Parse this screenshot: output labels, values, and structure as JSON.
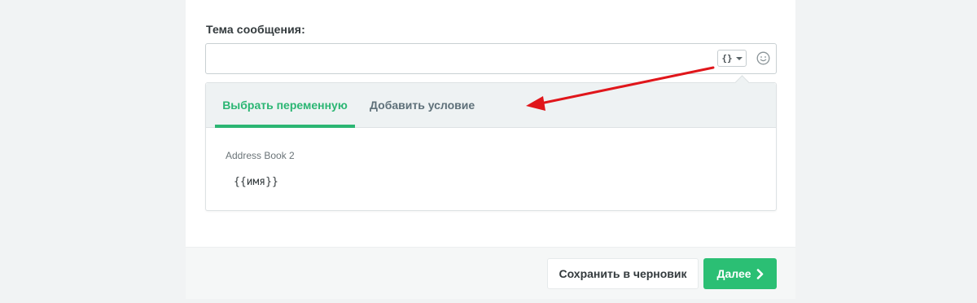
{
  "subject": {
    "label": "Тема сообщения:",
    "value": "",
    "placeholder": ""
  },
  "toolbar": {
    "variables_button_label": "{}",
    "variables_icon": "curly-braces-icon",
    "emoji_icon": "smiley-icon"
  },
  "dropdown": {
    "tabs": [
      {
        "label": "Выбрать переменную",
        "active": true
      },
      {
        "label": "Добавить условие",
        "active": false
      }
    ],
    "address_book": "Address Book 2",
    "variables": [
      "{{имя}}"
    ]
  },
  "actions": {
    "save_draft_label": "Сохранить в черновик",
    "next_label": "Далее",
    "next_icon": "chevron-right-icon"
  },
  "colors": {
    "accent": "#2bb673",
    "annotation_arrow": "#e0161b"
  }
}
